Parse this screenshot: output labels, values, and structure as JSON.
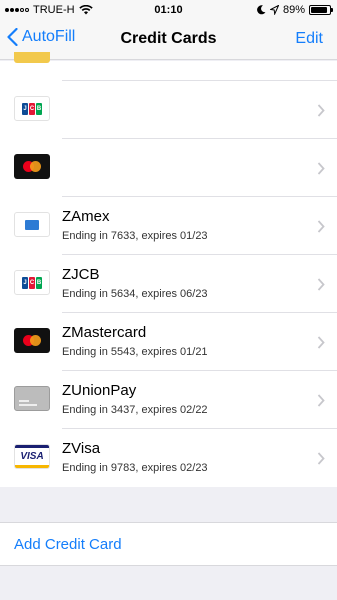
{
  "status_bar": {
    "carrier": "TRUE-H",
    "time": "01:10",
    "battery": "89%",
    "battery_level": 0.89
  },
  "nav": {
    "back_label": "AutoFill",
    "title": "Credit Cards",
    "edit_label": "Edit"
  },
  "cards": [
    {
      "name": "",
      "detail": "",
      "icon": "jcb-card-icon"
    },
    {
      "name": "",
      "detail": "",
      "icon": "mastercard-card-icon"
    },
    {
      "name": "ZAmex",
      "detail": "Ending in 7633, expires 01/23",
      "icon": "amex-card-icon"
    },
    {
      "name": "ZJCB",
      "detail": "Ending in 5634, expires 06/23",
      "icon": "jcb-card-icon"
    },
    {
      "name": "ZMastercard",
      "detail": "Ending in 5543, expires 01/21",
      "icon": "mastercard-card-icon"
    },
    {
      "name": "ZUnionPay",
      "detail": "Ending in 3437, expires 02/22",
      "icon": "unionpay-card-icon"
    },
    {
      "name": "ZVisa",
      "detail": "Ending in 9783, expires 02/23",
      "icon": "visa-card-icon"
    }
  ],
  "add_card_label": "Add Credit Card",
  "colors": {
    "accent": "#147efb",
    "background": "#efeff4"
  }
}
